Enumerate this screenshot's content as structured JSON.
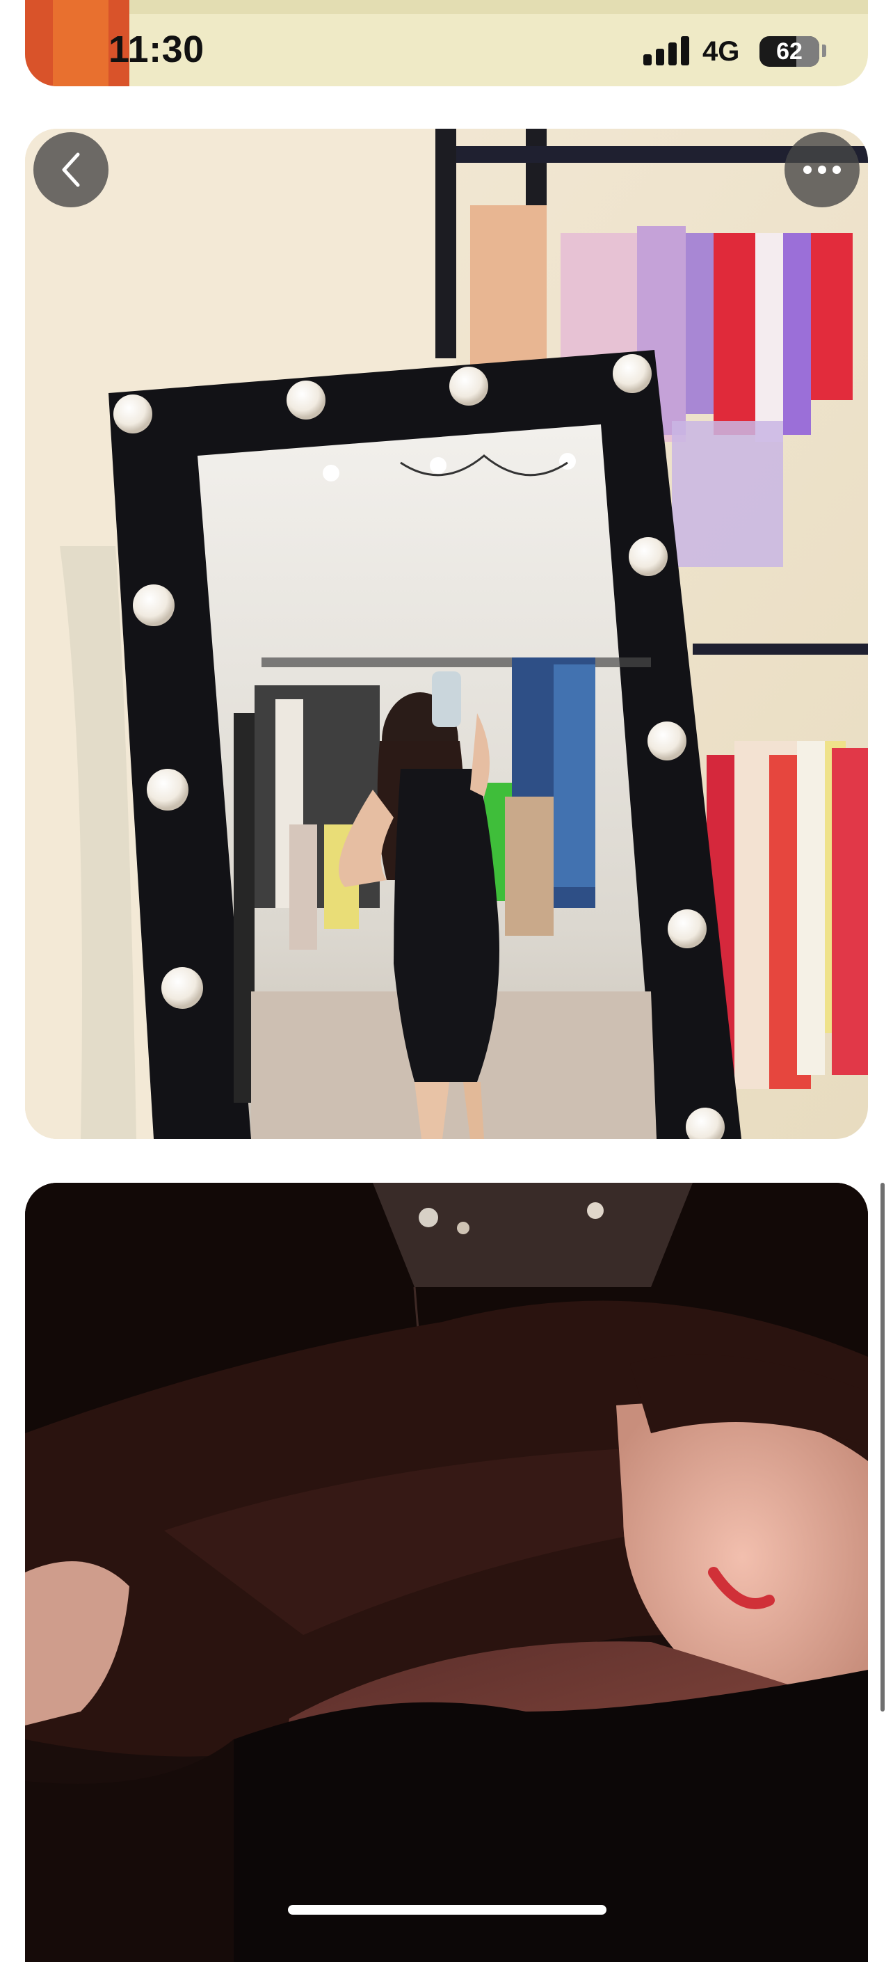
{
  "status_bar": {
    "time": "11:30",
    "network": "4G",
    "battery_level": "62",
    "battery_fraction": 0.62,
    "signal_bars": 4
  },
  "controls": {
    "back_icon": "chevron-left-icon",
    "more_icon": "ellipsis-icon"
  },
  "colors": {
    "card_top_background": "#f1ecc9",
    "button_background": "#464646",
    "page_background": "#ffffff"
  },
  "photos": [
    {
      "name": "photo-top-partial"
    },
    {
      "name": "photo-mirror-selfie"
    },
    {
      "name": "photo-dark-selfie"
    }
  ]
}
